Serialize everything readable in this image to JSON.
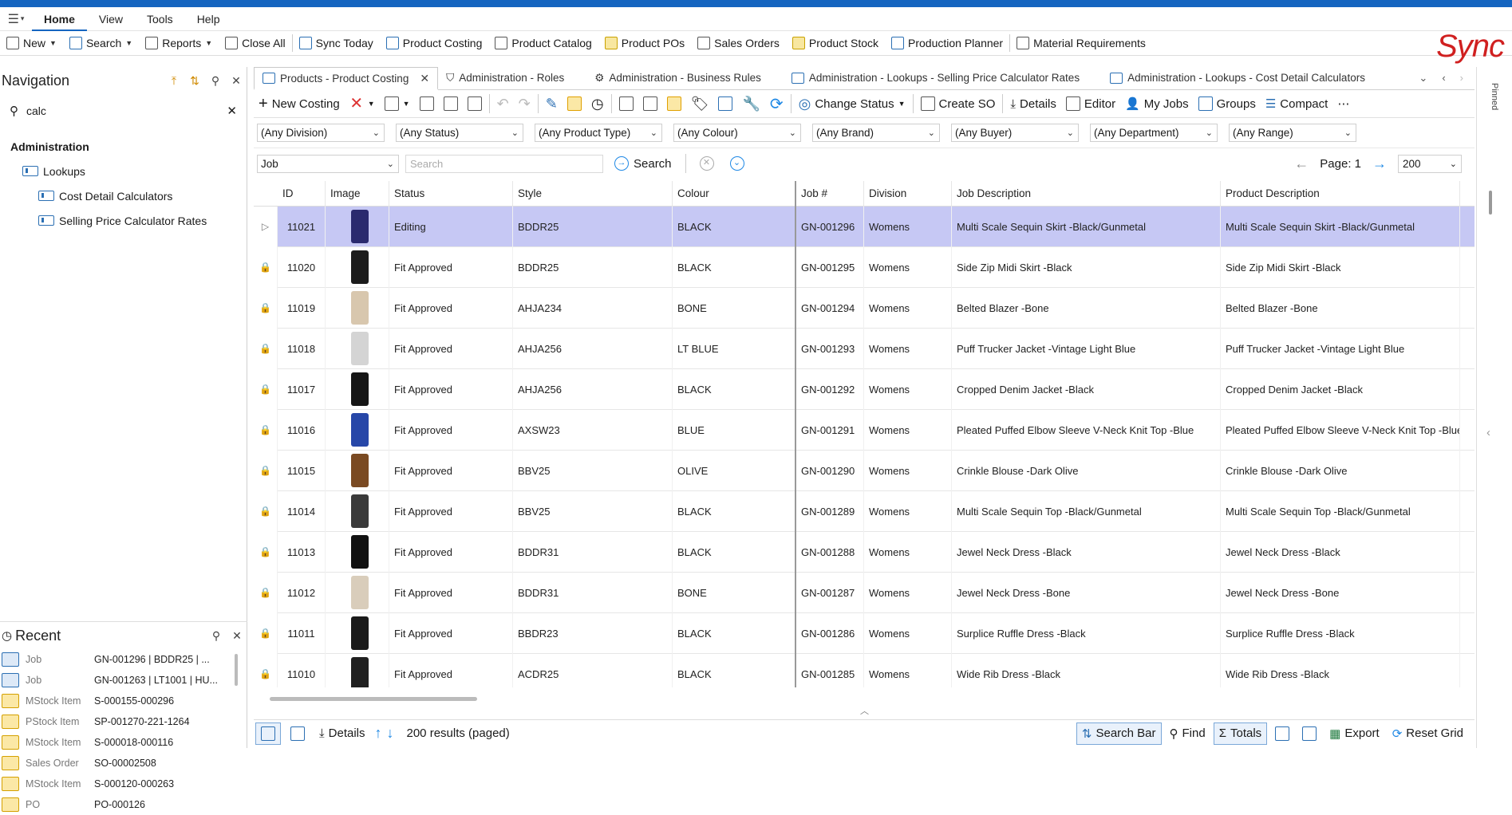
{
  "menu": {
    "items": [
      "Home",
      "View",
      "Tools",
      "Help"
    ],
    "active": "Home"
  },
  "ribbon": {
    "new": "New",
    "search": "Search",
    "reports": "Reports",
    "close_all": "Close All",
    "sync_today": "Sync Today",
    "product_costing": "Product Costing",
    "product_catalog": "Product Catalog",
    "product_pos": "Product POs",
    "sales_orders": "Sales Orders",
    "product_stock": "Product Stock",
    "production_planner": "Production Planner",
    "material_requirements": "Material Requirements",
    "logo": "Sync"
  },
  "navigation": {
    "title": "Navigation",
    "search_value": "calc",
    "tree": [
      {
        "label": "Administration",
        "level": "h"
      },
      {
        "label": "Lookups",
        "level": "l1"
      },
      {
        "label": "Cost Detail Calculators",
        "level": "l2"
      },
      {
        "label": "Selling Price Calculator Rates",
        "level": "l2"
      }
    ]
  },
  "recent": {
    "title": "Recent",
    "items": [
      {
        "type": "Job",
        "value": "GN-001296 |  BDDR25 | ..."
      },
      {
        "type": "Job",
        "value": "GN-001263 | LT1001 | HU..."
      },
      {
        "type": "MStock Item",
        "value": "S-000155-000296"
      },
      {
        "type": "PStock Item",
        "value": "SP-001270-221-1264"
      },
      {
        "type": "MStock Item",
        "value": "S-000018-000116"
      },
      {
        "type": "Sales Order",
        "value": "SO-00002508"
      },
      {
        "type": "MStock Item",
        "value": "S-000120-000263"
      },
      {
        "type": "PO",
        "value": "PO-000126"
      }
    ]
  },
  "tabs": [
    {
      "label": "Products - Product Costing",
      "active": true
    },
    {
      "label": "Administration - Roles"
    },
    {
      "label": "Administration - Business Rules"
    },
    {
      "label": "Administration - Lookups - Selling Price Calculator Rates"
    },
    {
      "label": "Administration - Lookups - Cost Detail Calculators"
    }
  ],
  "toolbar": {
    "new_costing": "New Costing",
    "change_status": "Change Status",
    "create_so": "Create SO",
    "details": "Details",
    "editor": "Editor",
    "my_jobs": "My Jobs",
    "groups": "Groups",
    "compact": "Compact"
  },
  "filters": [
    "(Any Division)",
    "(Any Status)",
    "(Any Product Type)",
    "(Any Colour)",
    "(Any Brand)",
    "(Any Buyer)",
    "(Any Department)",
    "(Any Range)"
  ],
  "search": {
    "field": "Job",
    "placeholder": "Search",
    "button": "Search",
    "page": "Page: 1",
    "page_size": "200"
  },
  "grid": {
    "columns": [
      "ID",
      "Image",
      "Status",
      "Style",
      "Colour",
      "Job #",
      "Division",
      "Job Description",
      "Product Description"
    ],
    "rows": [
      {
        "id": "11021",
        "status": "Editing",
        "style": "BDDR25",
        "colour": "BLACK",
        "job": "GN-001296",
        "division": "Womens",
        "job_desc": "Multi Scale Sequin Skirt -Black/Gunmetal",
        "prod_desc": "Multi Scale Sequin Skirt -Black/Gunmetal",
        "img": "#2a2a6e",
        "sel": true
      },
      {
        "id": "11020",
        "status": "Fit Approved",
        "style": "BDDR25",
        "colour": "BLACK",
        "job": "GN-001295",
        "division": "Womens",
        "job_desc": "Side Zip Midi Skirt -Black",
        "prod_desc": "Side Zip Midi Skirt -Black",
        "img": "#1c1c1c"
      },
      {
        "id": "11019",
        "status": "Fit Approved",
        "style": "AHJA234",
        "colour": "BONE",
        "job": "GN-001294",
        "division": "Womens",
        "job_desc": "Belted Blazer -Bone",
        "prod_desc": "Belted Blazer -Bone",
        "img": "#d8c7ae"
      },
      {
        "id": "11018",
        "status": "Fit Approved",
        "style": "AHJA256",
        "colour": "LT BLUE",
        "job": "GN-001293",
        "division": "Womens",
        "job_desc": "Puff Trucker Jacket -Vintage Light Blue",
        "prod_desc": "Puff Trucker Jacket -Vintage Light Blue",
        "img": "#d4d4d4"
      },
      {
        "id": "11017",
        "status": "Fit Approved",
        "style": "AHJA256",
        "colour": "BLACK",
        "job": "GN-001292",
        "division": "Womens",
        "job_desc": "Cropped Denim Jacket -Black",
        "prod_desc": "Cropped Denim Jacket -Black",
        "img": "#161616"
      },
      {
        "id": "11016",
        "status": "Fit Approved",
        "style": "AXSW23",
        "colour": "BLUE",
        "job": "GN-001291",
        "division": "Womens",
        "job_desc": "Pleated Puffed Elbow Sleeve V-Neck Knit Top -Blue",
        "prod_desc": "Pleated Puffed Elbow Sleeve V-Neck Knit Top -Blue",
        "img": "#2747a8"
      },
      {
        "id": "11015",
        "status": "Fit Approved",
        "style": "BBV25",
        "colour": "OLIVE",
        "job": "GN-001290",
        "division": "Womens",
        "job_desc": "Crinkle Blouse -Dark Olive",
        "prod_desc": "Crinkle Blouse -Dark Olive",
        "img": "#7a4a22"
      },
      {
        "id": "11014",
        "status": "Fit Approved",
        "style": "BBV25",
        "colour": "BLACK",
        "job": "GN-001289",
        "division": "Womens",
        "job_desc": "Multi Scale Sequin Top -Black/Gunmetal",
        "prod_desc": "Multi Scale Sequin Top -Black/Gunmetal",
        "img": "#3a3a3a"
      },
      {
        "id": "11013",
        "status": "Fit Approved",
        "style": "BDDR31",
        "colour": "BLACK",
        "job": "GN-001288",
        "division": "Womens",
        "job_desc": "Jewel Neck Dress -Black",
        "prod_desc": "Jewel Neck Dress -Black",
        "img": "#111111"
      },
      {
        "id": "11012",
        "status": "Fit Approved",
        "style": "BDDR31",
        "colour": "BONE",
        "job": "GN-001287",
        "division": "Womens",
        "job_desc": "Jewel Neck Dress -Bone",
        "prod_desc": "Jewel Neck Dress -Bone",
        "img": "#d9cdbb"
      },
      {
        "id": "11011",
        "status": "Fit Approved",
        "style": "BBDR23",
        "colour": "BLACK",
        "job": "GN-001286",
        "division": "Womens",
        "job_desc": "Surplice Ruffle Dress -Black",
        "prod_desc": "Surplice Ruffle Dress -Black",
        "img": "#1a1a1a"
      },
      {
        "id": "11010",
        "status": "Fit Approved",
        "style": "ACDR25",
        "colour": "BLACK",
        "job": "GN-001285",
        "division": "Womens",
        "job_desc": "Wide Rib Dress -Black",
        "prod_desc": "Wide Rib Dress -Black",
        "img": "#202020"
      }
    ]
  },
  "statusbar": {
    "details": "Details",
    "results": "200 results (paged)",
    "search_bar": "Search Bar",
    "find": "Find",
    "totals": "Totals",
    "export": "Export",
    "reset_grid": "Reset Grid"
  },
  "side": {
    "pinned": "Pinned"
  }
}
